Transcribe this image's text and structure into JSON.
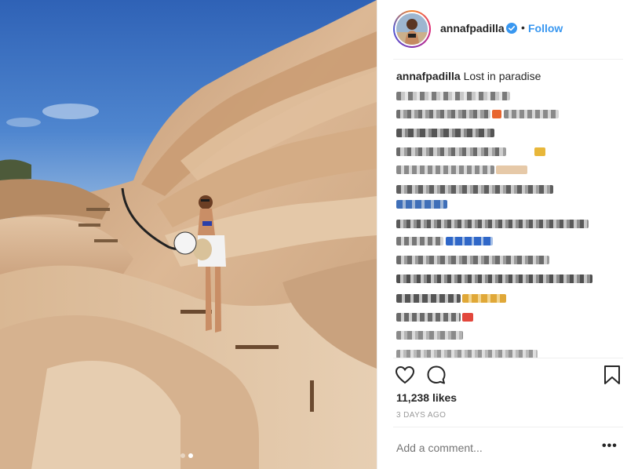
{
  "post": {
    "username": "annafpadilla",
    "verified": true,
    "separator": "•",
    "follow_label": "Follow",
    "caption_user": "annafpadilla",
    "caption_text": "Lost in paradise",
    "likes": "11,238 likes",
    "timestamp": "3 DAYS AGO",
    "comment_placeholder": "Add a comment...",
    "more_label": "•••"
  },
  "carousel": {
    "total": 2,
    "active_index": 1
  },
  "icons": {
    "like": "heart-icon",
    "comment": "comment-icon",
    "save": "bookmark-icon",
    "verified": "verified-badge-icon",
    "more": "more-options-icon"
  },
  "colors": {
    "link": "#3897f0",
    "verified": "#3897f0",
    "text": "#262626",
    "muted": "#999999"
  }
}
